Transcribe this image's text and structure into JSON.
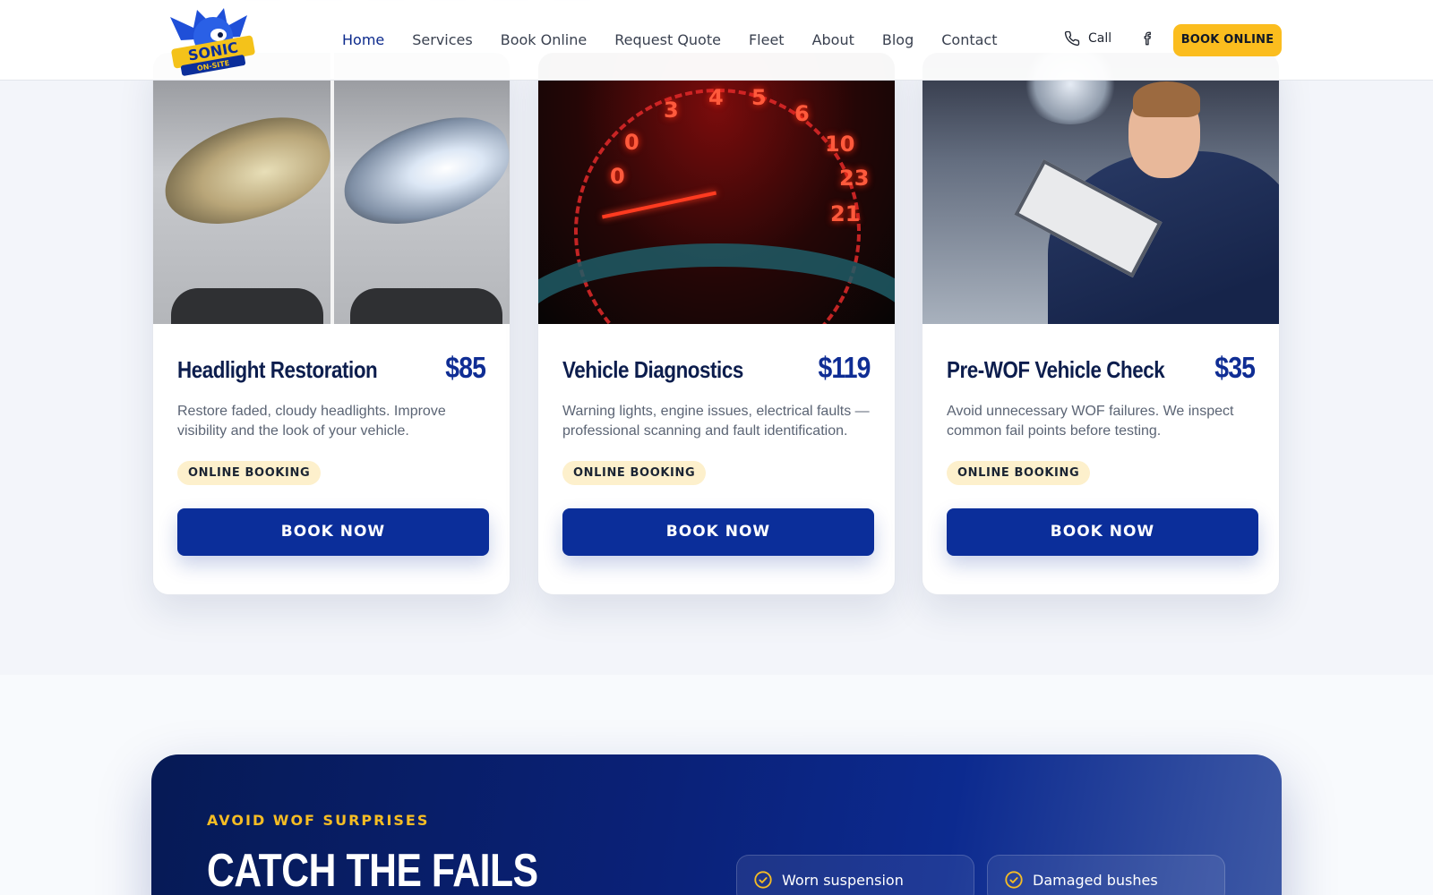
{
  "header": {
    "brand": "Sonic On-Site Solutions",
    "nav": [
      {
        "label": "Home",
        "active": true
      },
      {
        "label": "Services",
        "active": false
      },
      {
        "label": "Book Online",
        "active": false
      },
      {
        "label": "Request Quote",
        "active": false
      },
      {
        "label": "Fleet",
        "active": false
      },
      {
        "label": "About",
        "active": false
      },
      {
        "label": "Blog",
        "active": false
      },
      {
        "label": "Contact",
        "active": false
      }
    ],
    "call_label": "Call",
    "social_icon": "facebook-icon",
    "cta_label": "BOOK ONLINE"
  },
  "services": [
    {
      "title": "Headlight Restoration",
      "price": "$85",
      "description": "Restore faded, cloudy headlights. Improve visibility and the look of your vehicle.",
      "badge": "ONLINE BOOKING",
      "button": "BOOK NOW",
      "image": "headlight-before-after"
    },
    {
      "title": "Vehicle Diagnostics",
      "price": "$119",
      "description": "Warning lights, engine issues, electrical faults — professional scanning and fault identification.",
      "badge": "ONLINE BOOKING",
      "button": "BOOK NOW",
      "image": "dashboard-gauges"
    },
    {
      "title": "Pre-WOF Vehicle Check",
      "price": "$35",
      "description": "Avoid unnecessary WOF failures. We inspect common fail points before testing.",
      "badge": "ONLINE BOOKING",
      "button": "BOOK NOW",
      "image": "mechanic-inspection"
    }
  ],
  "banner": {
    "eyebrow": "AVOID WOF SURPRISES",
    "heading": "CATCH THE FAILS",
    "checks": [
      "Worn suspension",
      "Damaged bushes"
    ]
  },
  "colors": {
    "brand_blue": "#0b2e9a",
    "accent_yellow": "#fbbd1e",
    "badge_bg": "#fdf0cc"
  }
}
